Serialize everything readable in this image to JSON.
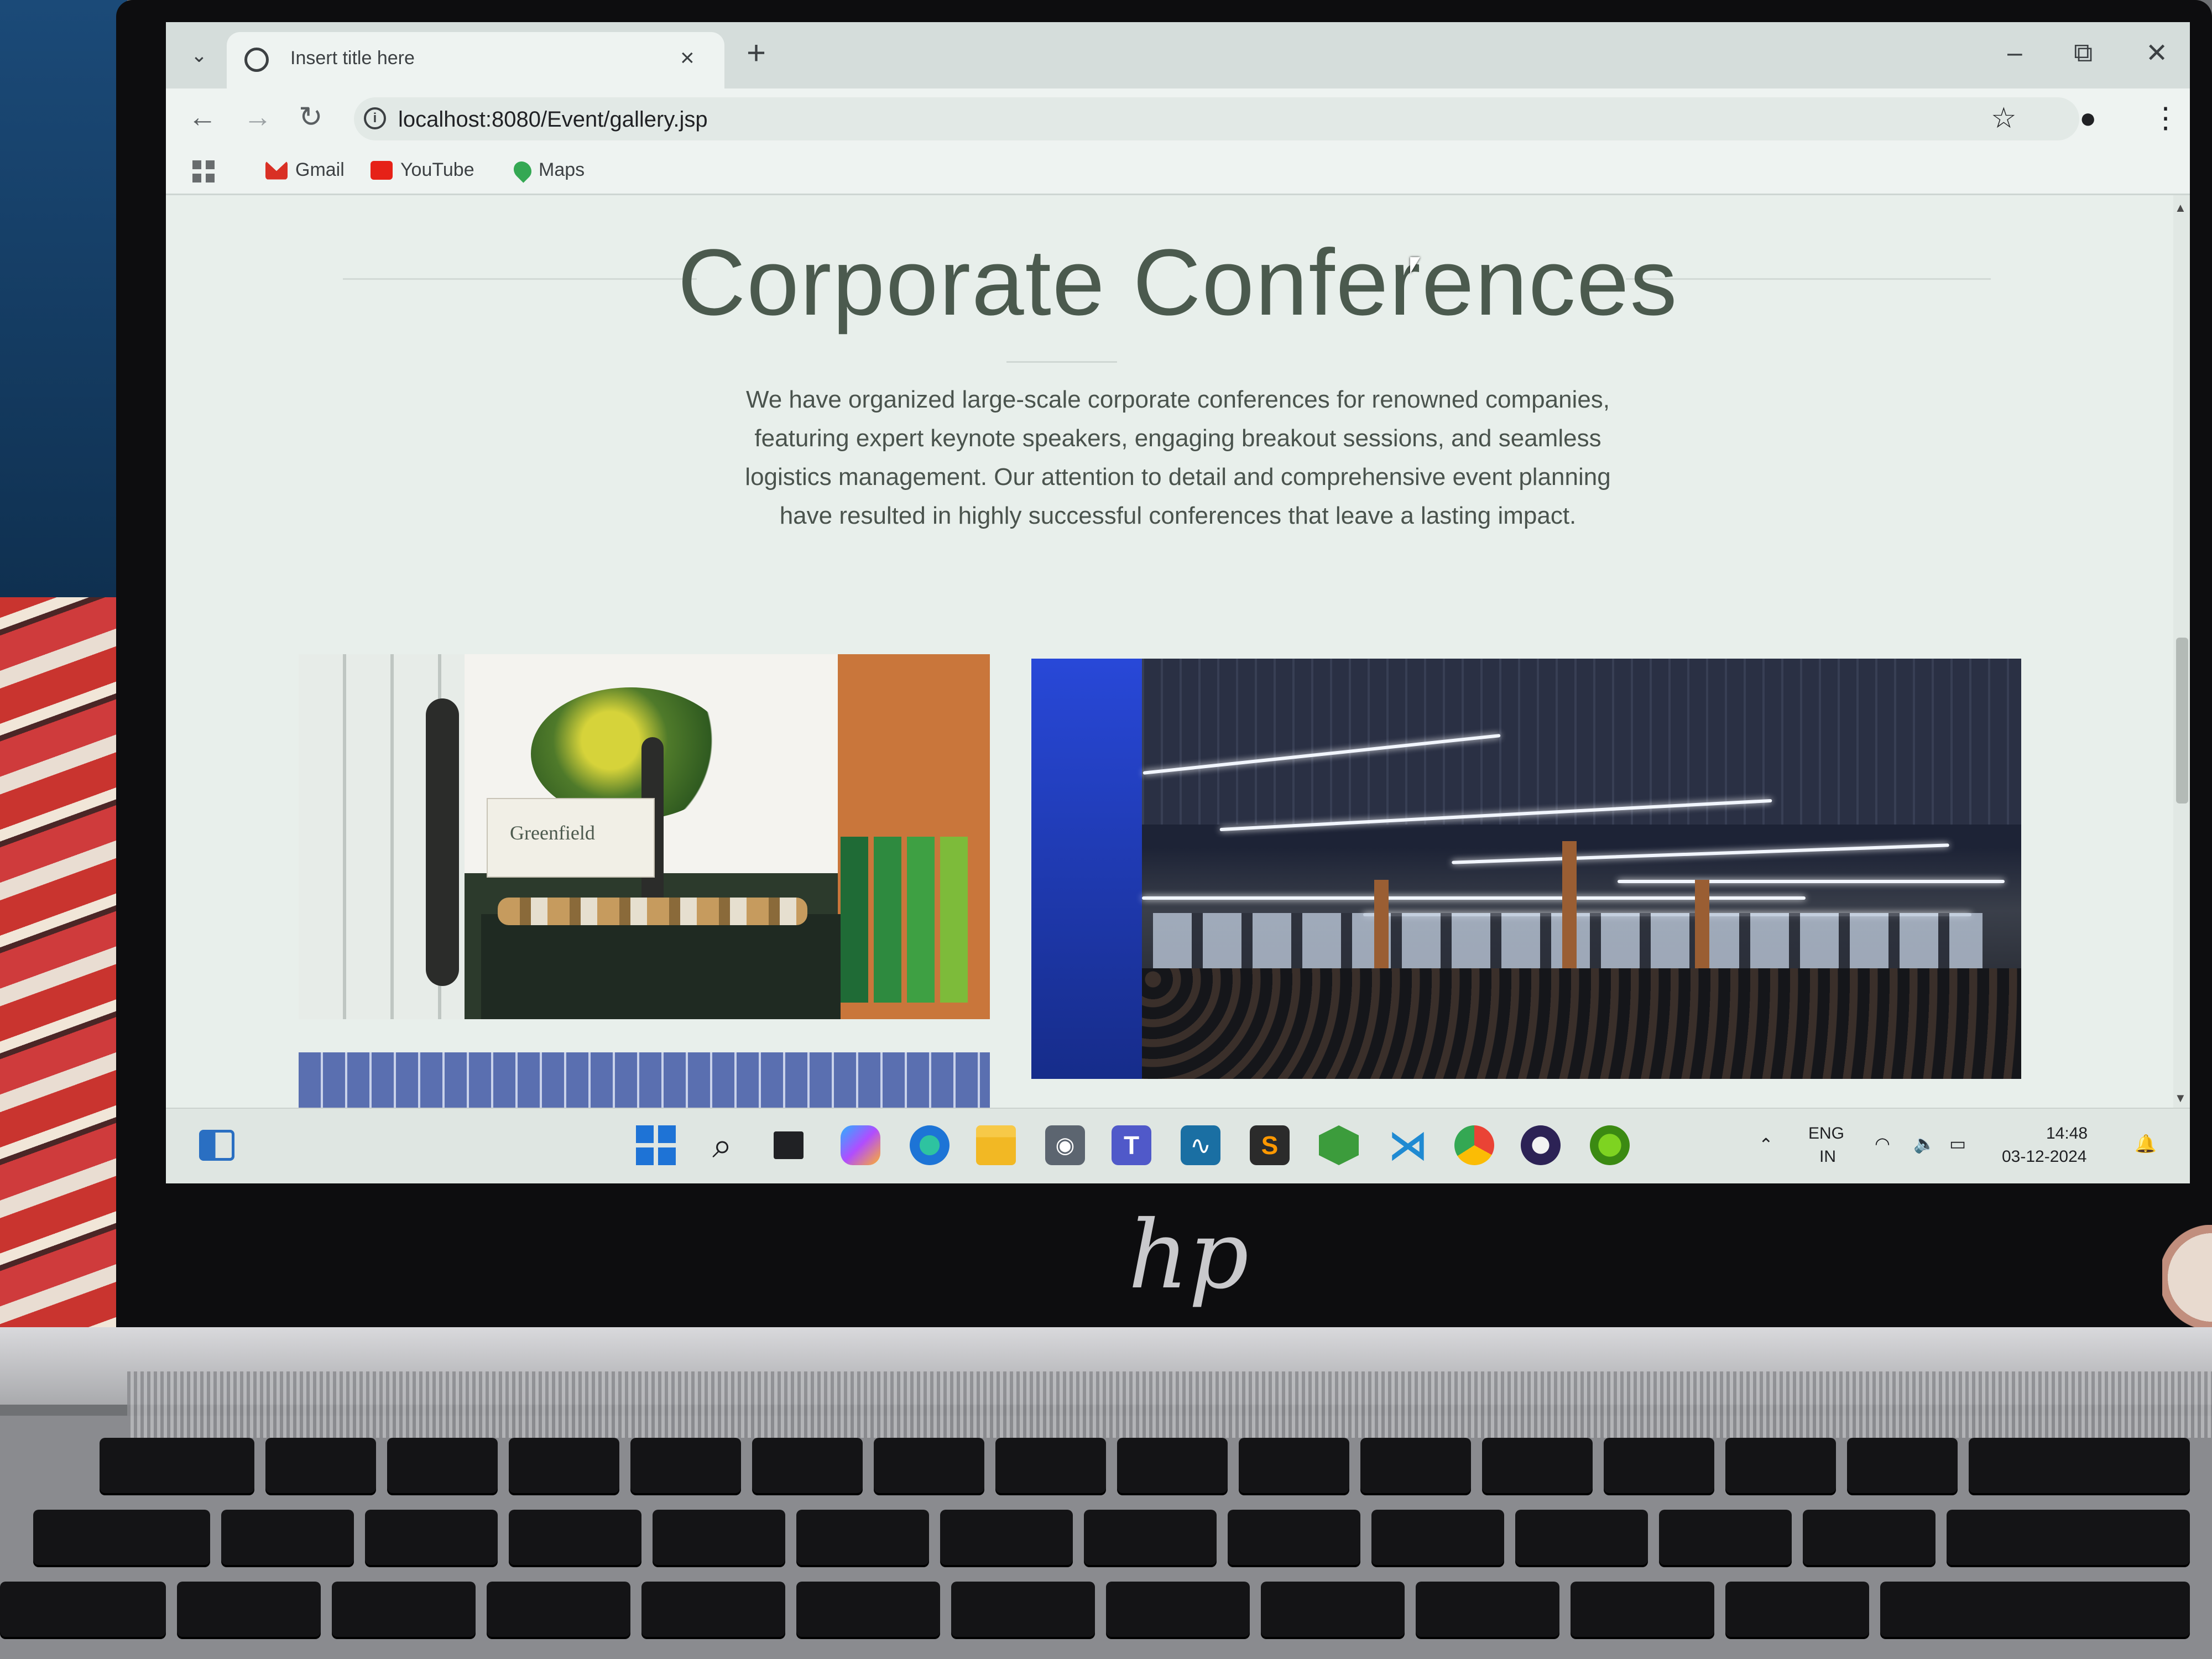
{
  "browser": {
    "tab_title": "Insert title here",
    "tab_close": "×",
    "new_tab": "+",
    "url": "localhost:8080/Event/gallery.jsp",
    "window_minimize": "–",
    "window_restore": "⧉",
    "window_close": "✕",
    "bookmarks": [
      {
        "label": "Gmail",
        "icon": "gmail-icon",
        "color": "#d93025"
      },
      {
        "label": "YouTube",
        "icon": "youtube-icon",
        "color": "#e62117"
      },
      {
        "label": "Maps",
        "icon": "maps-icon",
        "color": "#34a853"
      }
    ]
  },
  "page": {
    "title": "Corporate Conferences",
    "description": "We have organized large-scale corporate conferences for renowned companies, featuring expert keynote speakers, engaging breakout sessions, and seamless logistics management. Our attention to detail and comprehensive event planning have resulted in highly successful conferences that leave a lasting impact.",
    "photo_1_sign": "Greenfield"
  },
  "taskbar": {
    "apps": [
      "start-icon",
      "search-icon",
      "task-view-icon",
      "copilot-icon",
      "edge-icon",
      "file-explorer-icon",
      "camera-icon",
      "teams-icon",
      "mysql-workbench-icon",
      "sublime-text-icon",
      "nodejs-icon",
      "vscode-icon",
      "chrome-icon",
      "eclipse-icon",
      "spring-tools-icon"
    ],
    "lang_top": "ENG",
    "lang_bottom": "IN",
    "time": "14:48",
    "date": "03-12-2024"
  },
  "device": {
    "brand_logo": "hp"
  }
}
